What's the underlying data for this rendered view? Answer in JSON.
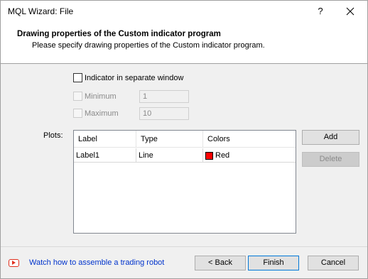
{
  "window": {
    "title": "MQL Wizard: File",
    "help_label": "?"
  },
  "header": {
    "title": "Drawing properties of the Custom indicator program",
    "subtitle": "Please specify drawing properties of the Custom indicator program."
  },
  "options": {
    "separate_window": {
      "label": "Indicator in separate window",
      "checked": false
    },
    "minimum": {
      "label": "Minimum",
      "value": "1",
      "enabled": false
    },
    "maximum": {
      "label": "Maximum",
      "value": "10",
      "enabled": false
    }
  },
  "plots": {
    "label": "Plots:",
    "columns": [
      "Label",
      "Type",
      "Colors"
    ],
    "rows": [
      {
        "label": "Label1",
        "type": "Line",
        "color_name": "Red",
        "color_hex": "#ff0000"
      }
    ],
    "add_label": "Add",
    "delete_label": "Delete"
  },
  "footer": {
    "link_text": "Watch how to assemble a trading robot",
    "link_icon": "youtube-play-icon",
    "back_label": "< Back",
    "finish_label": "Finish",
    "cancel_label": "Cancel"
  },
  "colors": {
    "accent": "#0078d7",
    "link": "#0033cc",
    "icon_red": "#e0301e"
  }
}
